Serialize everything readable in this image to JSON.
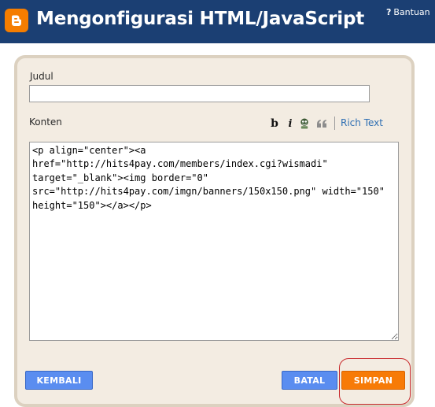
{
  "header": {
    "title": "Mengonfigurasi HTML/JavaScript",
    "help_icon": "?",
    "help_label": "Bantuan",
    "logo_icon": "blogger-logo-icon"
  },
  "form": {
    "title_label": "Judul",
    "title_value": "",
    "content_label": "Konten",
    "toolbar": {
      "bold_glyph": "b",
      "italic_glyph": "i",
      "image_icon": "insert-image-icon",
      "quote_glyph": "““",
      "rich_text_label": "Rich Text"
    },
    "content_value": "<p align=\"center\"><a href=\"http://hits4pay.com/members/index.cgi?wismadi\" target=\"_blank\"><img border=\"0\" src=\"http://hits4pay.com/imgn/banners/150x150.png\" width=\"150\" height=\"150\"></a></p>"
  },
  "buttons": {
    "back_label": "KEMBALI",
    "cancel_label": "BATAL",
    "save_label": "SIMPAN"
  },
  "colors": {
    "header_bg": "#1b3f73",
    "panel_bg": "#f3ece2",
    "panel_border": "#dcd1c0",
    "blue_button": "#5a8df0",
    "orange_button": "#f77b07",
    "link": "#2f6fb3",
    "highlight": "#c8282b"
  }
}
